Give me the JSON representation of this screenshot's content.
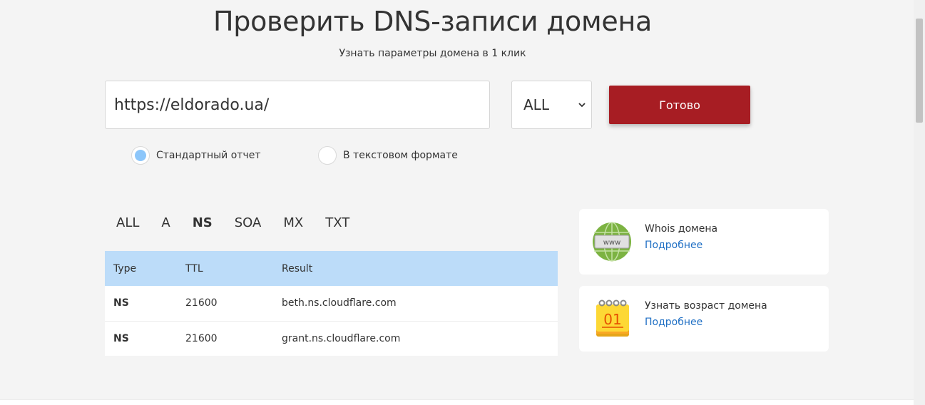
{
  "header": {
    "title": "Проверить DNS-записи домена",
    "subtitle": "Узнать параметры домена в 1 клик"
  },
  "form": {
    "url_value": "https://eldorado.ua/",
    "record_type_selected": "ALL",
    "submit_label": "Готово"
  },
  "report_format": {
    "options": [
      {
        "label": "Стандартный отчет",
        "selected": true
      },
      {
        "label": "В текстовом формате",
        "selected": false
      }
    ]
  },
  "record_tabs": [
    {
      "label": "ALL",
      "active": false
    },
    {
      "label": "A",
      "active": false
    },
    {
      "label": "NS",
      "active": true
    },
    {
      "label": "SOA",
      "active": false
    },
    {
      "label": "MX",
      "active": false
    },
    {
      "label": "TXT",
      "active": false
    }
  ],
  "results_table": {
    "headers": [
      "Type",
      "TTL",
      "Result"
    ],
    "rows": [
      [
        "NS",
        "21600",
        "beth.ns.cloudflare.com"
      ],
      [
        "NS",
        "21600",
        "grant.ns.cloudflare.com"
      ]
    ]
  },
  "sidebar_cards": [
    {
      "title": "Whois домена",
      "link": "Подробнее",
      "icon": "www-globe-icon"
    },
    {
      "title": "Узнать возраст домена",
      "link": "Подробнее",
      "icon": "calendar-icon"
    }
  ],
  "colors": {
    "accent_button": "#a71d23",
    "table_header": "#bcdcf9",
    "link": "#1f6fc4",
    "radio_selected": "#8cc6fa"
  }
}
